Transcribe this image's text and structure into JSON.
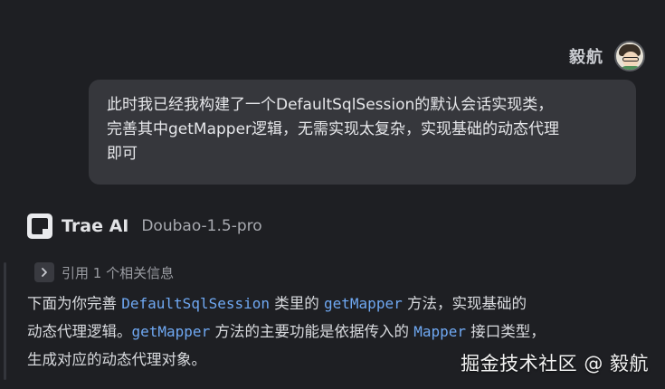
{
  "user": {
    "name": "毅航",
    "message_lines": [
      "此时我已经我构建了一个DefaultSqlSession的默认会话实现类，",
      "完善其中getMapper逻辑，无需实现太复杂，实现基础的动态代理",
      "即可"
    ]
  },
  "assistant": {
    "name": "Trae AI",
    "model": "Doubao-1.5-pro",
    "reference": "引用 1 个相关信息",
    "answer": {
      "l1_a": "下面为你完善 ",
      "l1_code1": "DefaultSqlSession",
      "l1_b": " 类里的 ",
      "l1_code2": "getMapper",
      "l1_c": " 方法，实现基础的",
      "l2_a": "动态代理逻辑。",
      "l2_code1": "getMapper",
      "l2_b": " 方法的主要功能是依据传入的 ",
      "l2_code2": "Mapper",
      "l2_c": " 接口类型，",
      "l3": "生成对应的动态代理对象。"
    }
  },
  "watermark": "掘金技术社区 @ 毅航",
  "colors": {
    "background": "#1e1f23",
    "bubble": "#36373c",
    "code": "#6fa8f2"
  },
  "icons": {
    "avatar": "user-avatar",
    "logo": "trae-logo-icon",
    "expand": "chevron-right-icon"
  }
}
